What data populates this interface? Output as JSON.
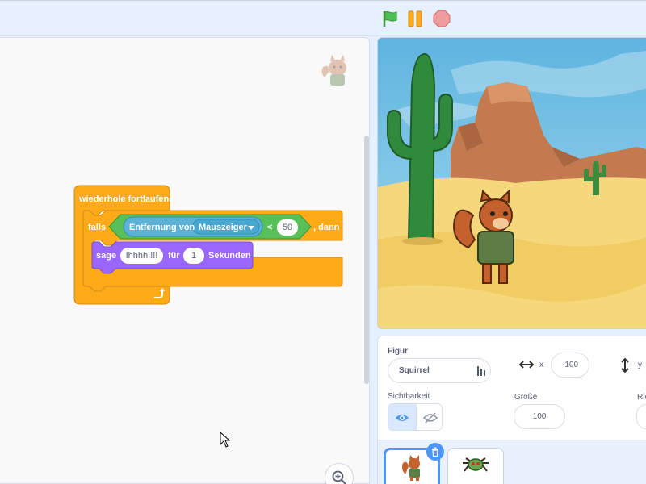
{
  "toolbar": {
    "green_flag_icon": "green-flag-icon",
    "pause_icon": "pause-icon",
    "stop_icon": "stop-icon"
  },
  "code": {
    "forever_label": "wiederhole fortlaufend",
    "if_label": "falls",
    "then_label": ", dann",
    "distance_label": "Entfernung von",
    "distance_target": "Mauszeiger",
    "less_than": "<",
    "compare_value": "50",
    "say_label": "sage",
    "say_text": "Ihhhh!!!!",
    "for_label": "für",
    "seconds_value": "1",
    "seconds_label": "Sekunden"
  },
  "sprite_info": {
    "sprite_label": "Figur",
    "sprite_name": "Squirrel",
    "x_label": "x",
    "x_value": "-100",
    "y_label": "y",
    "visibility_label": "Sichtbarkeit",
    "size_label": "Größe",
    "size_value": "100",
    "direction_label": "Ric"
  },
  "colors": {
    "control": "#ffab19",
    "control_dark": "#cf8b17",
    "sensing": "#5cb1d6",
    "operators": "#59c059",
    "looks": "#9966ff",
    "accent": "#4c97ff"
  }
}
